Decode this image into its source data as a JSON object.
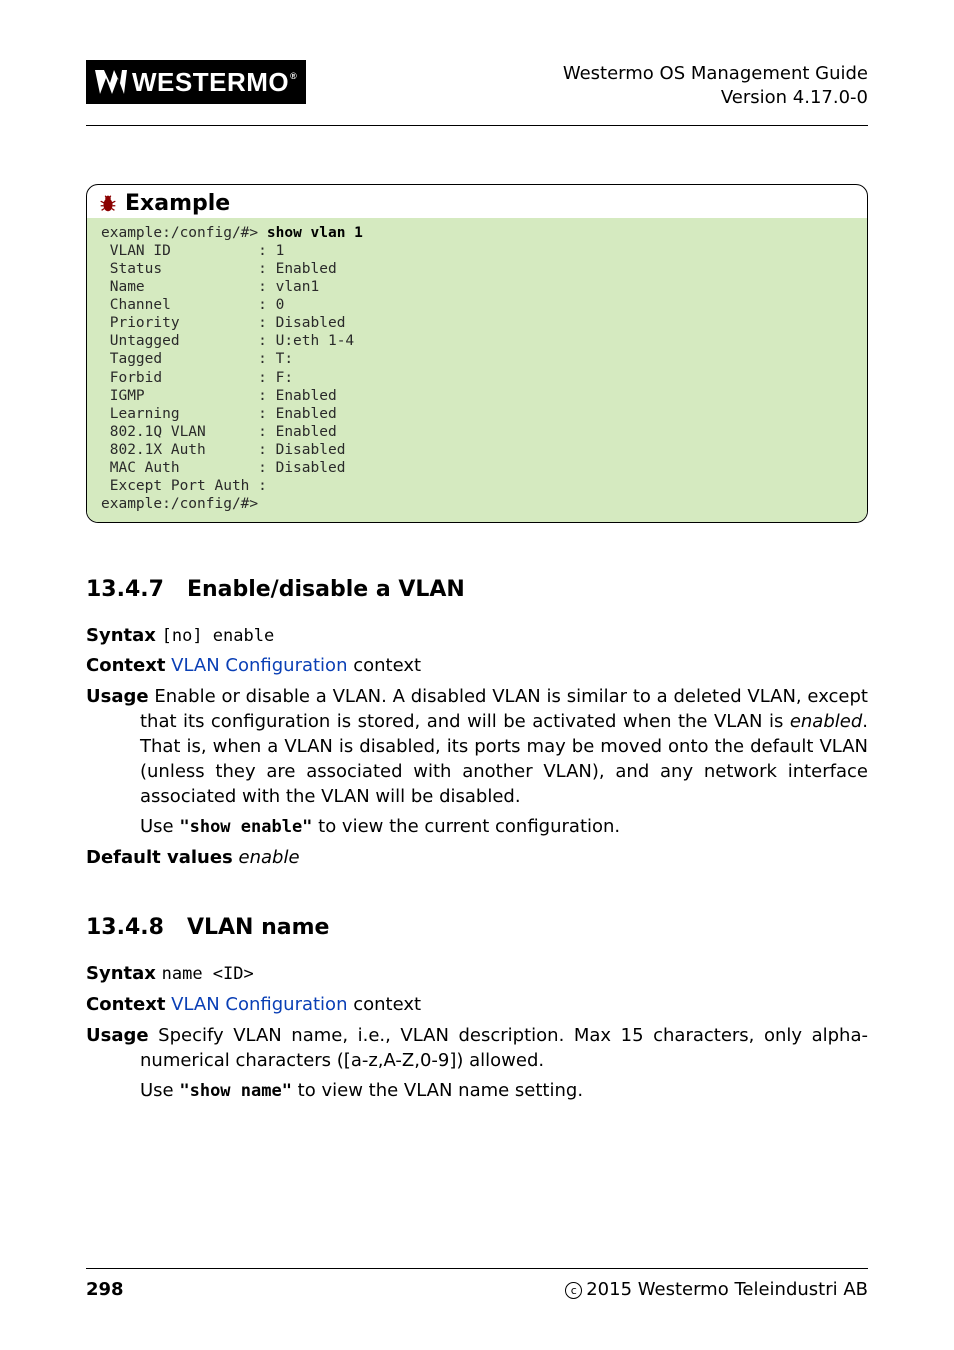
{
  "header": {
    "guide_title": "Westermo OS Management Guide",
    "version": "Version 4.17.0-0",
    "logo_text": "WESTERMO",
    "logo_trademark": "®"
  },
  "example": {
    "title": "Example",
    "prompt1_pre": "example:/config/#> ",
    "cmd1": "show vlan 1",
    "lines": [
      " VLAN ID          : 1",
      " Status           : Enabled",
      " Name             : vlan1",
      " Channel          : 0",
      " Priority         : Disabled",
      " Untagged         : U:eth 1-4",
      " Tagged           : T:",
      " Forbid           : F:",
      " IGMP             : Enabled",
      " Learning         : Enabled",
      " 802.1Q VLAN      : Enabled",
      " 802.1X Auth      : Disabled",
      " MAC Auth         : Disabled",
      " Except Port Auth :"
    ],
    "prompt2": "example:/config/#>"
  },
  "sec1": {
    "number": "13.4.7",
    "title": "Enable/disable a VLAN",
    "syntax_label": "Syntax",
    "syntax_val": "[no] enable",
    "context_label": "Context",
    "context_link": "VLAN Configuration",
    "context_suffix": " context",
    "usage_label": "Usage",
    "usage_text": "Enable or disable a VLAN. A disabled VLAN is similar to a deleted VLAN, except that its configuration is stored, and will be activated when the VLAN is ",
    "usage_enabled": "enabled",
    "usage_text2": ". That is, when a VLAN is disabled, its ports may be moved onto the default VLAN (unless they are associated with another VLAN), and any network interface associated with the VLAN will be disabled.",
    "usage_use": "Use ",
    "usage_cmd": "\"show enable\"",
    "usage_tail": " to view the current configuration.",
    "default_label": "Default values",
    "default_val": "enable"
  },
  "sec2": {
    "number": "13.4.8",
    "title": "VLAN name",
    "syntax_label": "Syntax",
    "syntax_val": "name <ID>",
    "context_label": "Context",
    "context_link": "VLAN Configuration",
    "context_suffix": " context",
    "usage_label": "Usage",
    "usage_text": "Specify VLAN name, i.e., VLAN description.  Max 15 characters, only alpha-numerical characters ([a-z,A-Z,0-9]) allowed.",
    "usage_use": "Use ",
    "usage_cmd": "\"show name\"",
    "usage_tail": " to view the VLAN name setting."
  },
  "footer": {
    "page": "298",
    "copyright": "2015 Westermo Teleindustri AB"
  }
}
